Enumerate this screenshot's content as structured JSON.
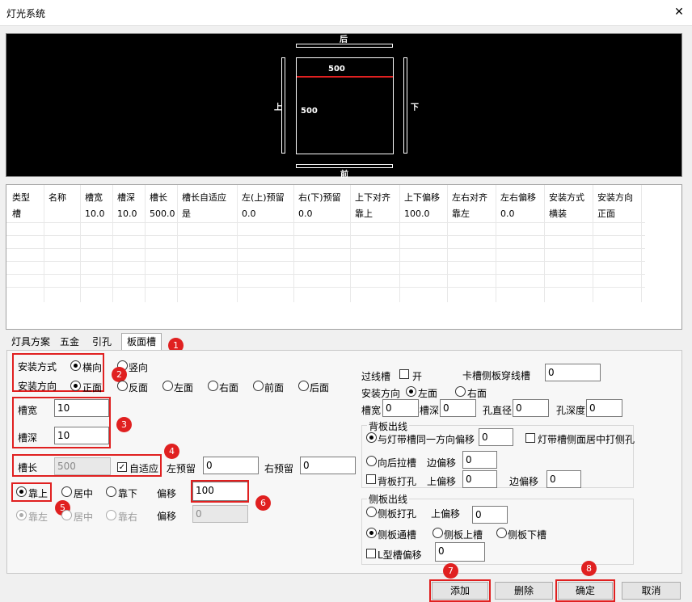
{
  "window": {
    "title": "灯光系统"
  },
  "preview": {
    "back": "后",
    "front": "前",
    "top_label": "上",
    "bottom_label": "下",
    "width": "500",
    "depth": "500"
  },
  "grid": {
    "headers": [
      "类型",
      "名称",
      "槽宽",
      "槽深",
      "槽长",
      "槽长自适应",
      "左(上)预留",
      "右(下)预留",
      "上下对齐",
      "上下偏移",
      "左右对齐",
      "左右偏移",
      "安装方式",
      "安装方向"
    ],
    "row": [
      "槽",
      "",
      "10.0",
      "10.0",
      "500.0",
      "是",
      "0.0",
      "0.0",
      "靠上",
      "100.0",
      "靠左",
      "0.0",
      "横装",
      "正面"
    ]
  },
  "tabs": [
    "灯具方案",
    "五金",
    "引孔",
    "板面槽"
  ],
  "left": {
    "install_mode_label": "安装方式",
    "horizontal": "横向",
    "vertical": "竖向",
    "install_dir_label": "安装方向",
    "dirs": [
      "正面",
      "反面",
      "左面",
      "右面",
      "前面",
      "后面"
    ],
    "slot_width_label": "槽宽",
    "slot_width": "10",
    "slot_depth_label": "槽深",
    "slot_depth": "10",
    "slot_length_label": "槽长",
    "slot_length": "500",
    "adaptive_label": "自适应",
    "left_reserve_label": "左预留",
    "left_reserve": "0",
    "right_reserve_label": "右预留",
    "right_reserve": "0",
    "align_top": "靠上",
    "align_mid": "居中",
    "align_bottom": "靠下",
    "offset_label": "偏移",
    "offset": "100",
    "align_left": "靠左",
    "align_center": "居中",
    "align_right": "靠右",
    "offset2_label": "偏移",
    "offset2": "0"
  },
  "right": {
    "wire_slot_label": "过线槽",
    "open_label": "开",
    "card_slot_label": "卡槽侧板穿线槽",
    "card_slot": "0",
    "install_dir_label": "安装方向",
    "dir_left": "左面",
    "dir_right": "右面",
    "slot_w_label": "槽宽",
    "slot_w": "0",
    "slot_d_label": "槽深",
    "slot_d": "0",
    "hole_dia_label": "孔直径",
    "hole_dia": "0",
    "hole_depth_label": "孔深度",
    "hole_depth": "0",
    "back_group": "背板出线",
    "same_dir_label": "与灯带槽同一方向偏移",
    "same_dir": "0",
    "side_center_label": "灯带槽侧面居中打侧孔",
    "pull_back_label": "向后拉槽",
    "edge_offset_label": "边偏移",
    "edge_offset": "0",
    "back_hole_label": "背板打孔",
    "top_offset_label": "上偏移",
    "top_offset": "0",
    "edge_offset2_label": "边偏移",
    "edge_offset2": "0",
    "side_group": "侧板出线",
    "side_hole_label": "侧板打孔",
    "side_top_offset_label": "上偏移",
    "side_top_offset": "0",
    "side_through_label": "侧板通槽",
    "side_upper_label": "侧板上槽",
    "side_lower_label": "侧板下槽",
    "l_slot_label": "L型槽偏移",
    "l_slot": "0"
  },
  "buttons": {
    "add": "添加",
    "delete": "删除",
    "ok": "确定",
    "cancel": "取消"
  },
  "badges": [
    "1",
    "2",
    "3",
    "4",
    "5",
    "6",
    "7",
    "8"
  ],
  "colors": {
    "highlight": "#e02020"
  }
}
